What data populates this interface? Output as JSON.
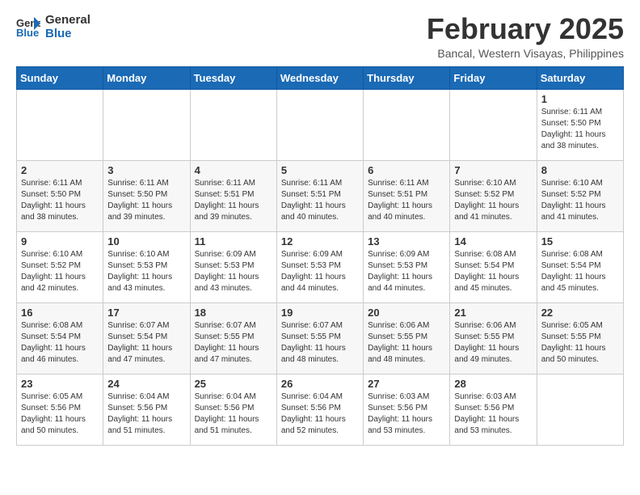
{
  "header": {
    "logo_line1": "General",
    "logo_line2": "Blue",
    "month_title": "February 2025",
    "location": "Bancal, Western Visayas, Philippines"
  },
  "days_of_week": [
    "Sunday",
    "Monday",
    "Tuesday",
    "Wednesday",
    "Thursday",
    "Friday",
    "Saturday"
  ],
  "weeks": [
    [
      {
        "day": "",
        "info": ""
      },
      {
        "day": "",
        "info": ""
      },
      {
        "day": "",
        "info": ""
      },
      {
        "day": "",
        "info": ""
      },
      {
        "day": "",
        "info": ""
      },
      {
        "day": "",
        "info": ""
      },
      {
        "day": "1",
        "info": "Sunrise: 6:11 AM\nSunset: 5:50 PM\nDaylight: 11 hours\nand 38 minutes."
      }
    ],
    [
      {
        "day": "2",
        "info": "Sunrise: 6:11 AM\nSunset: 5:50 PM\nDaylight: 11 hours\nand 38 minutes."
      },
      {
        "day": "3",
        "info": "Sunrise: 6:11 AM\nSunset: 5:50 PM\nDaylight: 11 hours\nand 39 minutes."
      },
      {
        "day": "4",
        "info": "Sunrise: 6:11 AM\nSunset: 5:51 PM\nDaylight: 11 hours\nand 39 minutes."
      },
      {
        "day": "5",
        "info": "Sunrise: 6:11 AM\nSunset: 5:51 PM\nDaylight: 11 hours\nand 40 minutes."
      },
      {
        "day": "6",
        "info": "Sunrise: 6:11 AM\nSunset: 5:51 PM\nDaylight: 11 hours\nand 40 minutes."
      },
      {
        "day": "7",
        "info": "Sunrise: 6:10 AM\nSunset: 5:52 PM\nDaylight: 11 hours\nand 41 minutes."
      },
      {
        "day": "8",
        "info": "Sunrise: 6:10 AM\nSunset: 5:52 PM\nDaylight: 11 hours\nand 41 minutes."
      }
    ],
    [
      {
        "day": "9",
        "info": "Sunrise: 6:10 AM\nSunset: 5:52 PM\nDaylight: 11 hours\nand 42 minutes."
      },
      {
        "day": "10",
        "info": "Sunrise: 6:10 AM\nSunset: 5:53 PM\nDaylight: 11 hours\nand 43 minutes."
      },
      {
        "day": "11",
        "info": "Sunrise: 6:09 AM\nSunset: 5:53 PM\nDaylight: 11 hours\nand 43 minutes."
      },
      {
        "day": "12",
        "info": "Sunrise: 6:09 AM\nSunset: 5:53 PM\nDaylight: 11 hours\nand 44 minutes."
      },
      {
        "day": "13",
        "info": "Sunrise: 6:09 AM\nSunset: 5:53 PM\nDaylight: 11 hours\nand 44 minutes."
      },
      {
        "day": "14",
        "info": "Sunrise: 6:08 AM\nSunset: 5:54 PM\nDaylight: 11 hours\nand 45 minutes."
      },
      {
        "day": "15",
        "info": "Sunrise: 6:08 AM\nSunset: 5:54 PM\nDaylight: 11 hours\nand 45 minutes."
      }
    ],
    [
      {
        "day": "16",
        "info": "Sunrise: 6:08 AM\nSunset: 5:54 PM\nDaylight: 11 hours\nand 46 minutes."
      },
      {
        "day": "17",
        "info": "Sunrise: 6:07 AM\nSunset: 5:54 PM\nDaylight: 11 hours\nand 47 minutes."
      },
      {
        "day": "18",
        "info": "Sunrise: 6:07 AM\nSunset: 5:55 PM\nDaylight: 11 hours\nand 47 minutes."
      },
      {
        "day": "19",
        "info": "Sunrise: 6:07 AM\nSunset: 5:55 PM\nDaylight: 11 hours\nand 48 minutes."
      },
      {
        "day": "20",
        "info": "Sunrise: 6:06 AM\nSunset: 5:55 PM\nDaylight: 11 hours\nand 48 minutes."
      },
      {
        "day": "21",
        "info": "Sunrise: 6:06 AM\nSunset: 5:55 PM\nDaylight: 11 hours\nand 49 minutes."
      },
      {
        "day": "22",
        "info": "Sunrise: 6:05 AM\nSunset: 5:55 PM\nDaylight: 11 hours\nand 50 minutes."
      }
    ],
    [
      {
        "day": "23",
        "info": "Sunrise: 6:05 AM\nSunset: 5:56 PM\nDaylight: 11 hours\nand 50 minutes."
      },
      {
        "day": "24",
        "info": "Sunrise: 6:04 AM\nSunset: 5:56 PM\nDaylight: 11 hours\nand 51 minutes."
      },
      {
        "day": "25",
        "info": "Sunrise: 6:04 AM\nSunset: 5:56 PM\nDaylight: 11 hours\nand 51 minutes."
      },
      {
        "day": "26",
        "info": "Sunrise: 6:04 AM\nSunset: 5:56 PM\nDaylight: 11 hours\nand 52 minutes."
      },
      {
        "day": "27",
        "info": "Sunrise: 6:03 AM\nSunset: 5:56 PM\nDaylight: 11 hours\nand 53 minutes."
      },
      {
        "day": "28",
        "info": "Sunrise: 6:03 AM\nSunset: 5:56 PM\nDaylight: 11 hours\nand 53 minutes."
      },
      {
        "day": "",
        "info": ""
      }
    ]
  ]
}
